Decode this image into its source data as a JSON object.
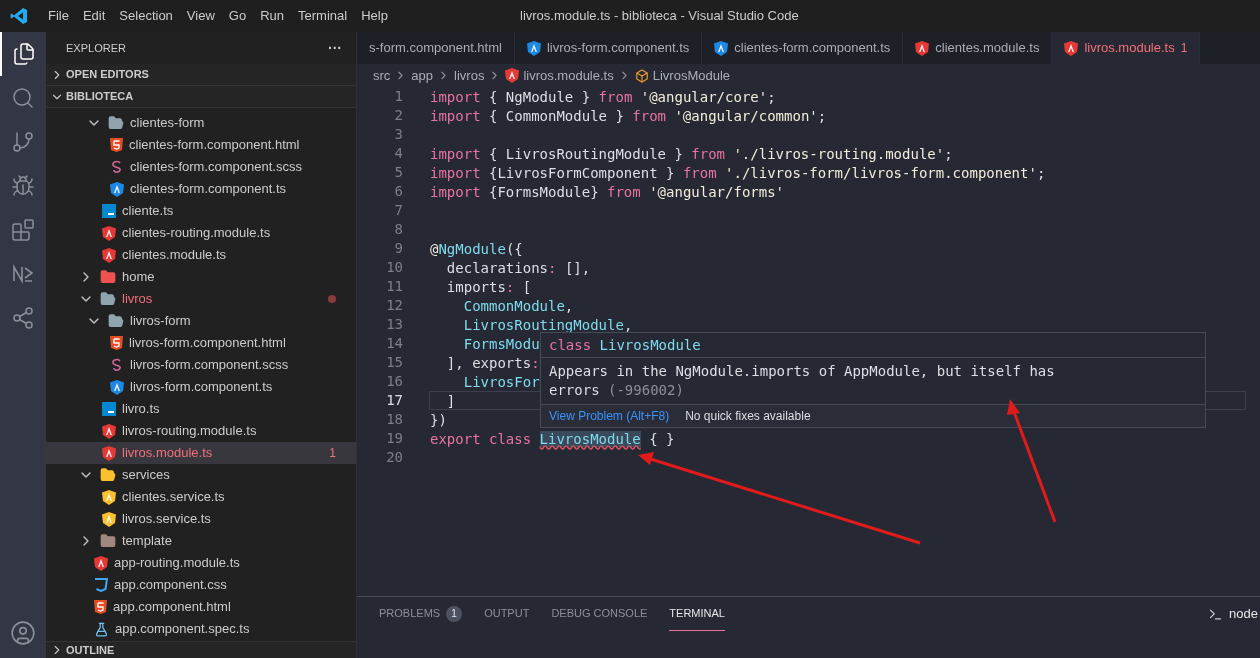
{
  "window": {
    "title": "livros.module.ts - biblioteca - Visual Studio Code"
  },
  "menu": [
    "File",
    "Edit",
    "Selection",
    "View",
    "Go",
    "Run",
    "Terminal",
    "Help"
  ],
  "activity_bar": [
    {
      "selected": true
    },
    {
      "selected": false
    },
    {
      "selected": false
    },
    {
      "selected": false
    },
    {
      "selected": false
    },
    {
      "selected": false
    },
    {
      "selected": false
    }
  ],
  "sidebar": {
    "title": "EXPLORER",
    "more": "···",
    "sections": [
      {
        "label": "OPEN EDITORS",
        "expanded": false
      },
      {
        "label": "BIBLIOTECA",
        "expanded": true
      }
    ],
    "tree": [
      {
        "children": [
          {
            "name": "clientes-form",
            "kind": "folder",
            "expanded": true,
            "selected": false,
            "error": false,
            "children": [
              {
                "name": "clientes-form.component.html",
                "kind": "html",
                "selected": false,
                "error": false
              },
              {
                "name": "clientes-form.component.scss",
                "kind": "scss",
                "selected": false,
                "error": false
              },
              {
                "name": "clientes-form.component.ts",
                "kind": "ng-blue",
                "selected": false,
                "error": false
              }
            ]
          },
          {
            "name": "cliente.ts",
            "kind": "ts",
            "selected": false,
            "error": false
          },
          {
            "name": "clientes-routing.module.ts",
            "kind": "ng-red",
            "selected": false,
            "error": false
          },
          {
            "name": "clientes.module.ts",
            "kind": "ng-red",
            "selected": false,
            "error": false
          }
        ]
      },
      {
        "name": "home",
        "kind": "folder-home",
        "expanded": false,
        "selected": false,
        "error": false
      },
      {
        "name": "livros",
        "kind": "folder",
        "expanded": true,
        "selected": false,
        "error": true,
        "children": [
          {
            "name": "livros-form",
            "kind": "folder",
            "expanded": true,
            "selected": false,
            "error": false,
            "children": [
              {
                "name": "livros-form.component.html",
                "kind": "html",
                "selected": false,
                "error": false
              },
              {
                "name": "livros-form.component.scss",
                "kind": "scss",
                "selected": false,
                "error": false
              },
              {
                "name": "livros-form.component.ts",
                "kind": "ng-blue",
                "selected": false,
                "error": false
              }
            ]
          },
          {
            "name": "livro.ts",
            "kind": "ts",
            "selected": false,
            "error": false
          },
          {
            "name": "livros-routing.module.ts",
            "kind": "ng-red",
            "selected": false,
            "error": false
          },
          {
            "name": "livros.module.ts",
            "kind": "ng-red",
            "selected": true,
            "error": true,
            "count": "1"
          }
        ]
      },
      {
        "name": "services",
        "kind": "folder-services",
        "expanded": true,
        "selected": false,
        "error": false,
        "children": [
          {
            "name": "clientes.service.ts",
            "kind": "ng-yellow",
            "selected": false,
            "error": false
          },
          {
            "name": "livros.service.ts",
            "kind": "ng-yellow",
            "selected": false,
            "error": false
          }
        ]
      },
      {
        "name": "template",
        "kind": "folder-template",
        "expanded": false,
        "selected": false,
        "error": false
      },
      {
        "name": "app-routing.module.ts",
        "kind": "ng-red",
        "selected": false,
        "error": false
      },
      {
        "name": "app.component.css",
        "kind": "css",
        "selected": false,
        "error": false
      },
      {
        "name": "app.component.html",
        "kind": "html",
        "selected": false,
        "error": false
      },
      {
        "name": "app.component.spec.ts",
        "kind": "test",
        "selected": false,
        "error": false
      }
    ],
    "outline": {
      "label": "OUTLINE",
      "expanded": false
    }
  },
  "tabs": [
    {
      "label": "s-form.component.html",
      "selected": false,
      "error": false
    },
    {
      "label": "livros-form.component.ts",
      "kind": "ng-blue",
      "selected": false,
      "error": false
    },
    {
      "label": "clientes-form.component.ts",
      "kind": "ng-blue",
      "selected": false,
      "error": false
    },
    {
      "label": "clientes.module.ts",
      "kind": "ng-red",
      "selected": false,
      "error": false
    },
    {
      "label": "livros.module.ts",
      "kind": "ng-red",
      "selected": true,
      "error": true,
      "count": "1"
    }
  ],
  "breadcrumb": [
    {
      "label": "src"
    },
    {
      "label": "app"
    },
    {
      "label": "livros"
    },
    {
      "label": "livros.module.ts",
      "kind": "ng-red"
    },
    {
      "label": "LivrosModule",
      "kind": "symbol"
    }
  ],
  "code": [
    {
      "number": "1",
      "current": false,
      "tokens": [
        {
          "kind": "kw",
          "text": "import"
        },
        {
          "kind": "plain",
          "text": " { NgModule } "
        },
        {
          "kind": "kw",
          "text": "from"
        },
        {
          "kind": "str",
          "text": " '@angular/core'"
        },
        {
          "kind": "plain",
          "text": ";"
        }
      ]
    },
    {
      "number": "2",
      "current": false,
      "tokens": [
        {
          "kind": "kw",
          "text": "import"
        },
        {
          "kind": "plain",
          "text": " { CommonModule } "
        },
        {
          "kind": "kw",
          "text": "from"
        },
        {
          "kind": "str",
          "text": " '@angular/common'"
        },
        {
          "kind": "plain",
          "text": ";"
        }
      ]
    },
    {
      "number": "3",
      "current": false
    },
    {
      "number": "4",
      "current": false,
      "tokens": [
        {
          "kind": "kw",
          "text": "import"
        },
        {
          "kind": "plain",
          "text": " { LivrosRoutingModule } "
        },
        {
          "kind": "kw",
          "text": "from"
        },
        {
          "kind": "str",
          "text": " './livros-routing.module'"
        },
        {
          "kind": "plain",
          "text": ";"
        }
      ]
    },
    {
      "number": "5",
      "current": false,
      "tokens": [
        {
          "kind": "kw",
          "text": "import"
        },
        {
          "kind": "plain",
          "text": " {LivrosFormComponent } "
        },
        {
          "kind": "kw",
          "text": "from"
        },
        {
          "kind": "str",
          "text": " './livros-form/livros-form.component'"
        },
        {
          "kind": "plain",
          "text": ";"
        }
      ]
    },
    {
      "number": "6",
      "current": false,
      "tokens": [
        {
          "kind": "kw",
          "text": "import"
        },
        {
          "kind": "plain",
          "text": " {FormsModule} "
        },
        {
          "kind": "kw",
          "text": "from"
        },
        {
          "kind": "str",
          "text": " '@angular/forms'"
        }
      ]
    },
    {
      "number": "7",
      "current": false
    },
    {
      "number": "8",
      "current": false
    },
    {
      "number": "9",
      "current": false,
      "tokens": [
        {
          "kind": "str",
          "text": "@"
        },
        {
          "kind": "ident",
          "text": "NgModule"
        },
        {
          "kind": "plain",
          "text": "({"
        }
      ]
    },
    {
      "number": "10",
      "current": false,
      "tokens": [
        {
          "kind": "plain",
          "text": "  declarations"
        },
        {
          "kind": "kw",
          "text": ":"
        },
        {
          "kind": "plain",
          "text": " [],"
        }
      ]
    },
    {
      "number": "11",
      "current": false,
      "tokens": [
        {
          "kind": "plain",
          "text": "  imports"
        },
        {
          "kind": "kw",
          "text": ":"
        },
        {
          "kind": "plain",
          "text": " ["
        }
      ]
    },
    {
      "number": "12",
      "current": false,
      "tokens": [
        {
          "kind": "ident",
          "text": "    CommonModule"
        },
        {
          "kind": "plain",
          "text": ","
        }
      ]
    },
    {
      "number": "13",
      "current": false,
      "tokens": [
        {
          "kind": "ident",
          "text": "    LivrosRoutingModule"
        },
        {
          "kind": "plain",
          "text": ","
        }
      ]
    },
    {
      "number": "14",
      "current": false,
      "tokens": [
        {
          "kind": "ident",
          "text": "    FormsModu"
        }
      ]
    },
    {
      "number": "15",
      "current": false,
      "tokens": [
        {
          "kind": "plain",
          "text": "  ], exports"
        },
        {
          "kind": "kw",
          "text": ":"
        }
      ]
    },
    {
      "number": "16",
      "current": false,
      "tokens": [
        {
          "kind": "ident",
          "text": "    LivrosFor"
        }
      ]
    },
    {
      "number": "17",
      "current": true,
      "tokens": [
        {
          "kind": "plain",
          "text": "  ]"
        }
      ]
    },
    {
      "number": "18",
      "current": false,
      "tokens": [
        {
          "kind": "plain",
          "text": "})"
        }
      ]
    },
    {
      "number": "19",
      "current": false,
      "tokens": [
        {
          "kind": "kw",
          "text": "export class "
        },
        {
          "kind": "ident",
          "text": "LivrosModule",
          "squiggle": true
        },
        {
          "kind": "plain",
          "text": " { }"
        }
      ]
    },
    {
      "number": "20",
      "current": false
    }
  ],
  "hover": {
    "keyword": "class",
    "name": "LivrosModule",
    "message": "Appears in the NgModule.imports of AppModule, but itself has errors",
    "code": "(-996002)",
    "action": "View Problem (Alt+F8)",
    "note": "No quick fixes available"
  },
  "panel": {
    "tabs": [
      {
        "label": "PROBLEMS",
        "selected": false,
        "count": "1"
      },
      {
        "label": "OUTPUT",
        "selected": false
      },
      {
        "label": "DEBUG CONSOLE",
        "selected": false
      },
      {
        "label": "TERMINAL",
        "selected": true
      }
    ],
    "terminal": "node"
  }
}
